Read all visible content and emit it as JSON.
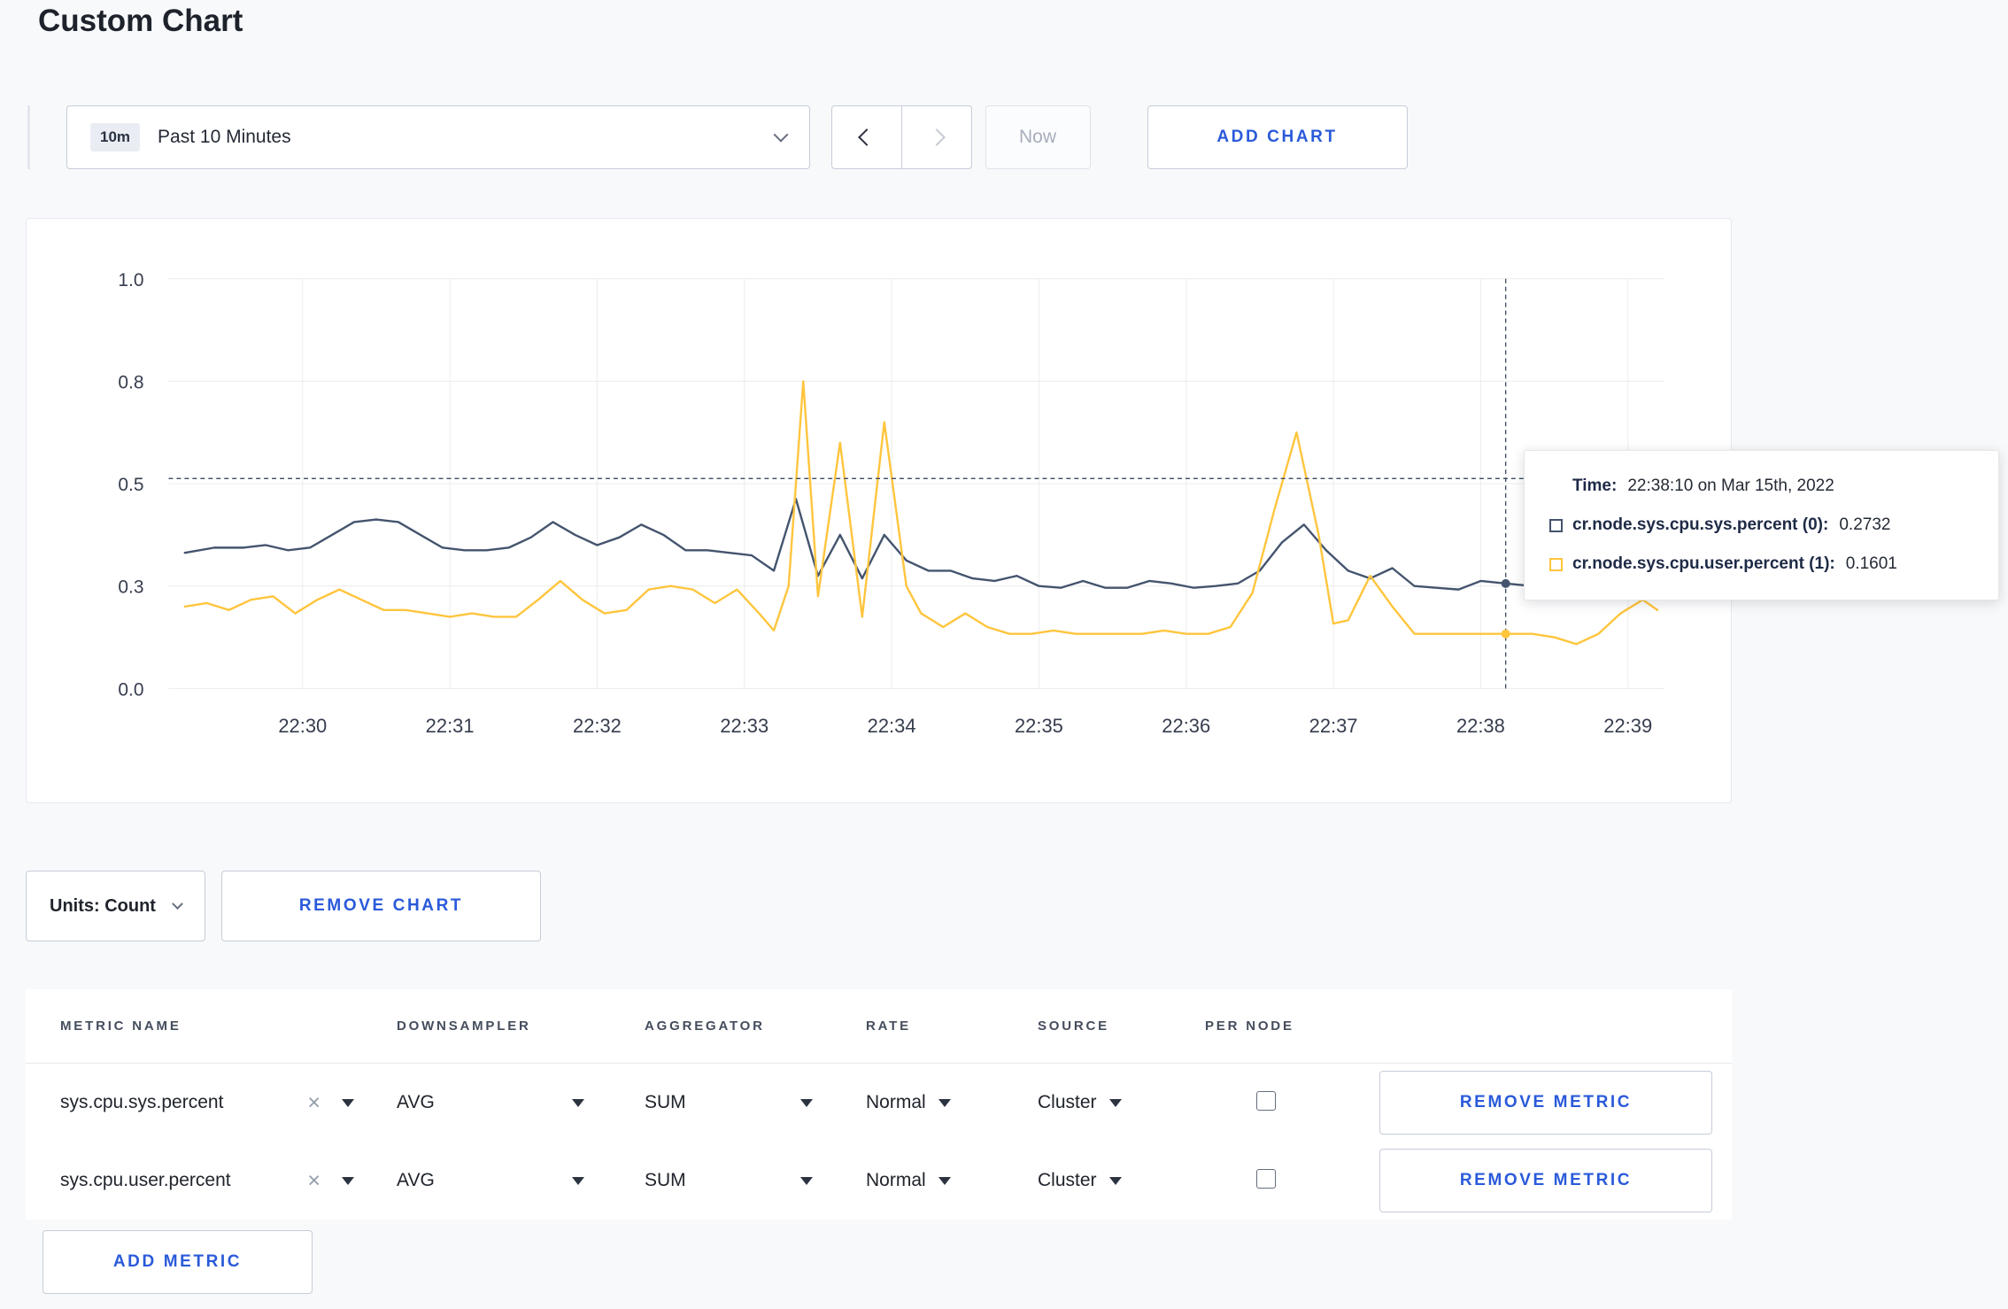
{
  "page": {
    "title": "Custom Chart"
  },
  "colors": {
    "accent": "#2a5ada",
    "series_sys": "#44546e",
    "series_user": "#ffc53d",
    "grid": "#ececec",
    "crosshair": "#3c4a66"
  },
  "toolbar": {
    "time_badge": "10m",
    "time_label": "Past 10 Minutes",
    "now_label": "Now",
    "add_chart_label": "ADD CHART"
  },
  "tooltip": {
    "time_label": "Time:",
    "time_value": "22:38:10 on Mar 15th, 2022",
    "rows": [
      {
        "label": "cr.node.sys.cpu.sys.percent (0):",
        "value": "0.2732",
        "color": "#44546e"
      },
      {
        "label": "cr.node.sys.cpu.user.percent (1):",
        "value": "0.1601",
        "color": "#ffc53d"
      }
    ]
  },
  "chart_controls": {
    "units_label": "Units: Count",
    "remove_chart_label": "REMOVE CHART"
  },
  "metrics_table": {
    "headers": [
      "METRIC NAME",
      "DOWNSAMPLER",
      "AGGREGATOR",
      "RATE",
      "SOURCE",
      "PER NODE"
    ],
    "rows": [
      {
        "name": "sys.cpu.sys.percent",
        "downsampler": "AVG",
        "aggregator": "SUM",
        "rate": "Normal",
        "source": "Cluster",
        "per_node": false,
        "remove_label": "REMOVE METRIC"
      },
      {
        "name": "sys.cpu.user.percent",
        "downsampler": "AVG",
        "aggregator": "SUM",
        "rate": "Normal",
        "source": "Cluster",
        "per_node": false,
        "remove_label": "REMOVE METRIC"
      }
    ],
    "add_metric_label": "ADD METRIC"
  },
  "chart_data": {
    "type": "line",
    "title": "",
    "xlabel": "",
    "ylabel": "",
    "ylim": [
      0,
      1
    ],
    "grid": true,
    "y_ticks": [
      0,
      0.3,
      0.5,
      0.8,
      1.0
    ],
    "y_tick_labels": [
      "0.0",
      "0.3",
      "0.5",
      "0.8",
      "1.0"
    ],
    "x_domain": [
      29.09,
      39.25
    ],
    "x_tick_minutes": [
      30,
      31,
      32,
      33,
      34,
      35,
      36,
      37,
      38,
      39
    ],
    "x_tick_labels": [
      "22:30",
      "22:31",
      "22:32",
      "22:33",
      "22:34",
      "22:35",
      "22:36",
      "22:37",
      "22:38",
      "22:39"
    ],
    "crosshair": {
      "t": 38.17,
      "hline": 0.515,
      "time_text": "22:38:10 on Mar 15th, 2022"
    },
    "series": [
      {
        "name": "cr.node.sys.cpu.sys.percent",
        "color": "#44546e",
        "points": [
          [
            29.2,
            0.365
          ],
          [
            29.4,
            0.375
          ],
          [
            29.6,
            0.375
          ],
          [
            29.75,
            0.38
          ],
          [
            29.9,
            0.37
          ],
          [
            30.05,
            0.375
          ],
          [
            30.2,
            0.4
          ],
          [
            30.35,
            0.425
          ],
          [
            30.5,
            0.43
          ],
          [
            30.65,
            0.425
          ],
          [
            30.8,
            0.4
          ],
          [
            30.95,
            0.375
          ],
          [
            31.1,
            0.37
          ],
          [
            31.25,
            0.37
          ],
          [
            31.4,
            0.375
          ],
          [
            31.55,
            0.395
          ],
          [
            31.7,
            0.425
          ],
          [
            31.85,
            0.4
          ],
          [
            32.0,
            0.38
          ],
          [
            32.15,
            0.395
          ],
          [
            32.3,
            0.42
          ],
          [
            32.45,
            0.4
          ],
          [
            32.6,
            0.37
          ],
          [
            32.75,
            0.37
          ],
          [
            32.9,
            0.365
          ],
          [
            33.05,
            0.36
          ],
          [
            33.2,
            0.33
          ],
          [
            33.35,
            0.47
          ],
          [
            33.5,
            0.32
          ],
          [
            33.65,
            0.4
          ],
          [
            33.8,
            0.315
          ],
          [
            33.95,
            0.4
          ],
          [
            34.1,
            0.35
          ],
          [
            34.25,
            0.33
          ],
          [
            34.4,
            0.33
          ],
          [
            34.55,
            0.315
          ],
          [
            34.7,
            0.31
          ],
          [
            34.85,
            0.32
          ],
          [
            35.0,
            0.3
          ],
          [
            35.15,
            0.295
          ],
          [
            35.3,
            0.31
          ],
          [
            35.45,
            0.295
          ],
          [
            35.6,
            0.295
          ],
          [
            35.75,
            0.31
          ],
          [
            35.9,
            0.305
          ],
          [
            36.05,
            0.295
          ],
          [
            36.2,
            0.3
          ],
          [
            36.35,
            0.305
          ],
          [
            36.5,
            0.33
          ],
          [
            36.65,
            0.385
          ],
          [
            36.8,
            0.42
          ],
          [
            36.95,
            0.37
          ],
          [
            37.1,
            0.33
          ],
          [
            37.25,
            0.315
          ],
          [
            37.4,
            0.335
          ],
          [
            37.55,
            0.3
          ],
          [
            37.7,
            0.295
          ],
          [
            37.85,
            0.29
          ],
          [
            38.0,
            0.31
          ],
          [
            38.17,
            0.305
          ],
          [
            38.35,
            0.3
          ],
          [
            38.5,
            0.295
          ],
          [
            38.65,
            0.3
          ],
          [
            38.8,
            0.305
          ],
          [
            38.95,
            0.3
          ],
          [
            39.1,
            0.3
          ],
          [
            39.2,
            0.31
          ]
        ]
      },
      {
        "name": "cr.node.sys.cpu.user.percent",
        "color": "#ffc53d",
        "points": [
          [
            29.2,
            0.24
          ],
          [
            29.35,
            0.25
          ],
          [
            29.5,
            0.23
          ],
          [
            29.65,
            0.26
          ],
          [
            29.8,
            0.27
          ],
          [
            29.95,
            0.22
          ],
          [
            30.1,
            0.26
          ],
          [
            30.25,
            0.29
          ],
          [
            30.4,
            0.26
          ],
          [
            30.55,
            0.23
          ],
          [
            30.7,
            0.23
          ],
          [
            30.85,
            0.22
          ],
          [
            31.0,
            0.21
          ],
          [
            31.15,
            0.22
          ],
          [
            31.3,
            0.21
          ],
          [
            31.45,
            0.21
          ],
          [
            31.6,
            0.26
          ],
          [
            31.75,
            0.31
          ],
          [
            31.9,
            0.26
          ],
          [
            32.05,
            0.22
          ],
          [
            32.2,
            0.23
          ],
          [
            32.35,
            0.29
          ],
          [
            32.5,
            0.3
          ],
          [
            32.65,
            0.29
          ],
          [
            32.8,
            0.25
          ],
          [
            32.95,
            0.29
          ],
          [
            33.1,
            0.22
          ],
          [
            33.2,
            0.17
          ],
          [
            33.3,
            0.3
          ],
          [
            33.4,
            0.8
          ],
          [
            33.5,
            0.27
          ],
          [
            33.65,
            0.62
          ],
          [
            33.8,
            0.21
          ],
          [
            33.95,
            0.68
          ],
          [
            34.1,
            0.3
          ],
          [
            34.2,
            0.22
          ],
          [
            34.35,
            0.18
          ],
          [
            34.5,
            0.22
          ],
          [
            34.65,
            0.18
          ],
          [
            34.8,
            0.16
          ],
          [
            34.95,
            0.16
          ],
          [
            35.1,
            0.17
          ],
          [
            35.25,
            0.16
          ],
          [
            35.4,
            0.16
          ],
          [
            35.55,
            0.16
          ],
          [
            35.7,
            0.16
          ],
          [
            35.85,
            0.17
          ],
          [
            36.0,
            0.16
          ],
          [
            36.15,
            0.16
          ],
          [
            36.3,
            0.18
          ],
          [
            36.45,
            0.28
          ],
          [
            36.6,
            0.45
          ],
          [
            36.75,
            0.65
          ],
          [
            36.9,
            0.4
          ],
          [
            37.0,
            0.19
          ],
          [
            37.1,
            0.2
          ],
          [
            37.25,
            0.32
          ],
          [
            37.4,
            0.24
          ],
          [
            37.55,
            0.16
          ],
          [
            37.7,
            0.16
          ],
          [
            37.85,
            0.16
          ],
          [
            38.0,
            0.16
          ],
          [
            38.17,
            0.16
          ],
          [
            38.35,
            0.16
          ],
          [
            38.5,
            0.15
          ],
          [
            38.65,
            0.13
          ],
          [
            38.8,
            0.16
          ],
          [
            38.95,
            0.22
          ],
          [
            39.1,
            0.26
          ],
          [
            39.2,
            0.23
          ]
        ]
      }
    ]
  }
}
